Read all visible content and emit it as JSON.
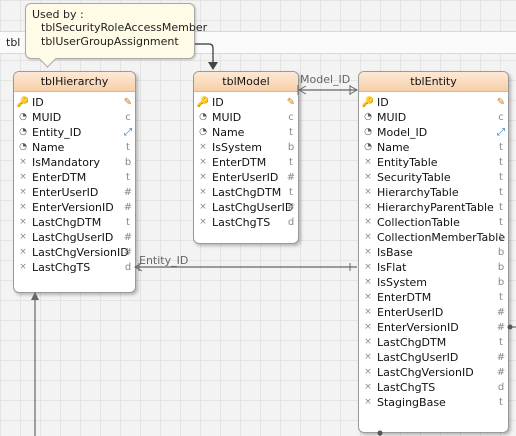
{
  "header": {
    "tab_label": "tbl"
  },
  "tooltip": {
    "title": "Used by :",
    "lines": [
      "tblSecurityRoleAccessMember",
      "tblUserGroupAssignment"
    ]
  },
  "relations": {
    "model_id": "Model_ID",
    "entity_id": "Entity_ID"
  },
  "icons": {
    "key": "primary-key-icon",
    "uid": "unique-id-icon",
    "field": "field-icon",
    "type_pencil": "pencil-icon",
    "type_link": "link-icon"
  },
  "entities": [
    {
      "name": "tblHierarchy",
      "columns": [
        {
          "name": "ID",
          "icon": "key",
          "type": "pen"
        },
        {
          "name": "MUID",
          "icon": "uid",
          "type": "c"
        },
        {
          "name": "Entity_ID",
          "icon": "uid",
          "type": "link"
        },
        {
          "name": "Name",
          "icon": "uid",
          "type": "t"
        },
        {
          "name": "IsMandatory",
          "icon": "field",
          "type": "b"
        },
        {
          "name": "EnterDTM",
          "icon": "field",
          "type": "t"
        },
        {
          "name": "EnterUserID",
          "icon": "field",
          "type": "#"
        },
        {
          "name": "EnterVersionID",
          "icon": "field",
          "type": "#"
        },
        {
          "name": "LastChgDTM",
          "icon": "field",
          "type": "t"
        },
        {
          "name": "LastChgUserID",
          "icon": "field",
          "type": "#"
        },
        {
          "name": "LastChgVersionID",
          "icon": "field",
          "type": "#"
        },
        {
          "name": "LastChgTS",
          "icon": "field",
          "type": "d"
        }
      ]
    },
    {
      "name": "tblModel",
      "columns": [
        {
          "name": "ID",
          "icon": "key",
          "type": "pen"
        },
        {
          "name": "MUID",
          "icon": "uid",
          "type": "c"
        },
        {
          "name": "Name",
          "icon": "uid",
          "type": "t"
        },
        {
          "name": "IsSystem",
          "icon": "field",
          "type": "b"
        },
        {
          "name": "EnterDTM",
          "icon": "field",
          "type": "t"
        },
        {
          "name": "EnterUserID",
          "icon": "field",
          "type": "#"
        },
        {
          "name": "LastChgDTM",
          "icon": "field",
          "type": "t"
        },
        {
          "name": "LastChgUserID",
          "icon": "field",
          "type": "#"
        },
        {
          "name": "LastChgTS",
          "icon": "field",
          "type": "d"
        }
      ]
    },
    {
      "name": "tblEntity",
      "columns": [
        {
          "name": "ID",
          "icon": "key",
          "type": "pen"
        },
        {
          "name": "MUID",
          "icon": "uid",
          "type": "c"
        },
        {
          "name": "Model_ID",
          "icon": "uid",
          "type": "link"
        },
        {
          "name": "Name",
          "icon": "uid",
          "type": "t"
        },
        {
          "name": "EntityTable",
          "icon": "field",
          "type": "t"
        },
        {
          "name": "SecurityTable",
          "icon": "field",
          "type": "t"
        },
        {
          "name": "HierarchyTable",
          "icon": "field",
          "type": "t"
        },
        {
          "name": "HierarchyParentTable",
          "icon": "field",
          "type": "t"
        },
        {
          "name": "CollectionTable",
          "icon": "field",
          "type": "t"
        },
        {
          "name": "CollectionMemberTable",
          "icon": "field",
          "type": "t"
        },
        {
          "name": "IsBase",
          "icon": "field",
          "type": "b"
        },
        {
          "name": "IsFlat",
          "icon": "field",
          "type": "b"
        },
        {
          "name": "IsSystem",
          "icon": "field",
          "type": "b"
        },
        {
          "name": "EnterDTM",
          "icon": "field",
          "type": "t"
        },
        {
          "name": "EnterUserID",
          "icon": "field",
          "type": "#"
        },
        {
          "name": "EnterVersionID",
          "icon": "field",
          "type": "#"
        },
        {
          "name": "LastChgDTM",
          "icon": "field",
          "type": "t"
        },
        {
          "name": "LastChgUserID",
          "icon": "field",
          "type": "#"
        },
        {
          "name": "LastChgVersionID",
          "icon": "field",
          "type": "#"
        },
        {
          "name": "LastChgTS",
          "icon": "field",
          "type": "d"
        },
        {
          "name": "StagingBase",
          "icon": "field",
          "type": "t"
        }
      ]
    }
  ]
}
